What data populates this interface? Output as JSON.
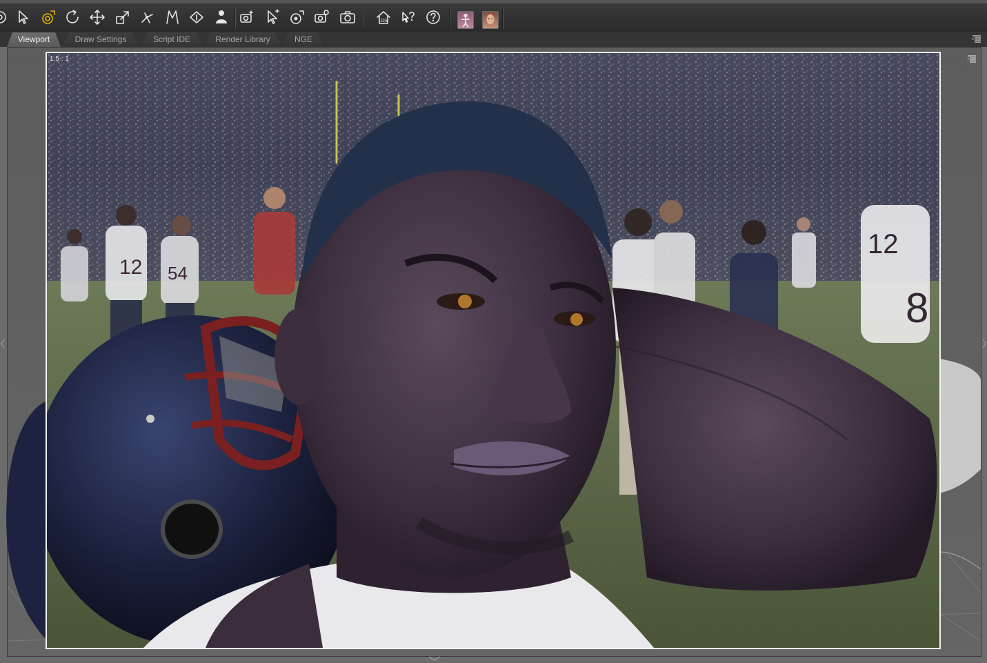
{
  "toolbar": {
    "tools": [
      {
        "name": "node-selection-tool",
        "icon": "target-icon"
      },
      {
        "name": "pointer-tool",
        "icon": "arrow-pointer-icon"
      },
      {
        "name": "universal-tool",
        "icon": "universal-gizmo-icon",
        "active": true
      },
      {
        "name": "rotate-tool",
        "icon": "rotate-icon"
      },
      {
        "name": "translate-tool",
        "icon": "move-arrows-icon"
      },
      {
        "name": "scale-tool",
        "icon": "scale-icon"
      },
      {
        "name": "joint-editor",
        "icon": "joint-editor-icon"
      },
      {
        "name": "geometry-editor",
        "icon": "geometry-editor-icon"
      },
      {
        "name": "surface-selection-tool",
        "icon": "surface-selection-icon"
      },
      {
        "name": "power-pose-tool",
        "icon": "power-pose-icon"
      },
      {
        "name": "spot-render-tool",
        "icon": "spot-render-icon"
      },
      {
        "name": "region-navigator",
        "icon": "region-navigator-icon"
      },
      {
        "name": "transform-active-pose",
        "icon": "active-pose-icon"
      },
      {
        "name": "render-settings",
        "icon": "render-settings-icon"
      },
      {
        "name": "render-button",
        "icon": "camera-icon"
      },
      {
        "name": "daz-home",
        "icon": "ds-home-icon"
      },
      {
        "name": "whats-this",
        "icon": "whats-this-icon"
      },
      {
        "name": "help",
        "icon": "help-icon"
      }
    ],
    "figure_buttons": [
      {
        "name": "figure-body-thumbnail",
        "icon": "figure-body-icon"
      },
      {
        "name": "figure-face-thumbnail",
        "icon": "figure-face-icon"
      }
    ]
  },
  "tabs": [
    {
      "label": "Viewport",
      "active": true
    },
    {
      "label": "Draw Settings",
      "active": false
    },
    {
      "label": "Script IDE",
      "active": false
    },
    {
      "label": "Render Library",
      "active": false
    },
    {
      "label": "NGE",
      "active": false
    }
  ],
  "viewport": {
    "aspect_ratio_label": "1.5 : 1",
    "scene_icon": "rendered-football-player-scene"
  },
  "colors": {
    "accent": "#e8b400",
    "frame_border": "#f2f2f2",
    "active_tab": "#626262"
  }
}
